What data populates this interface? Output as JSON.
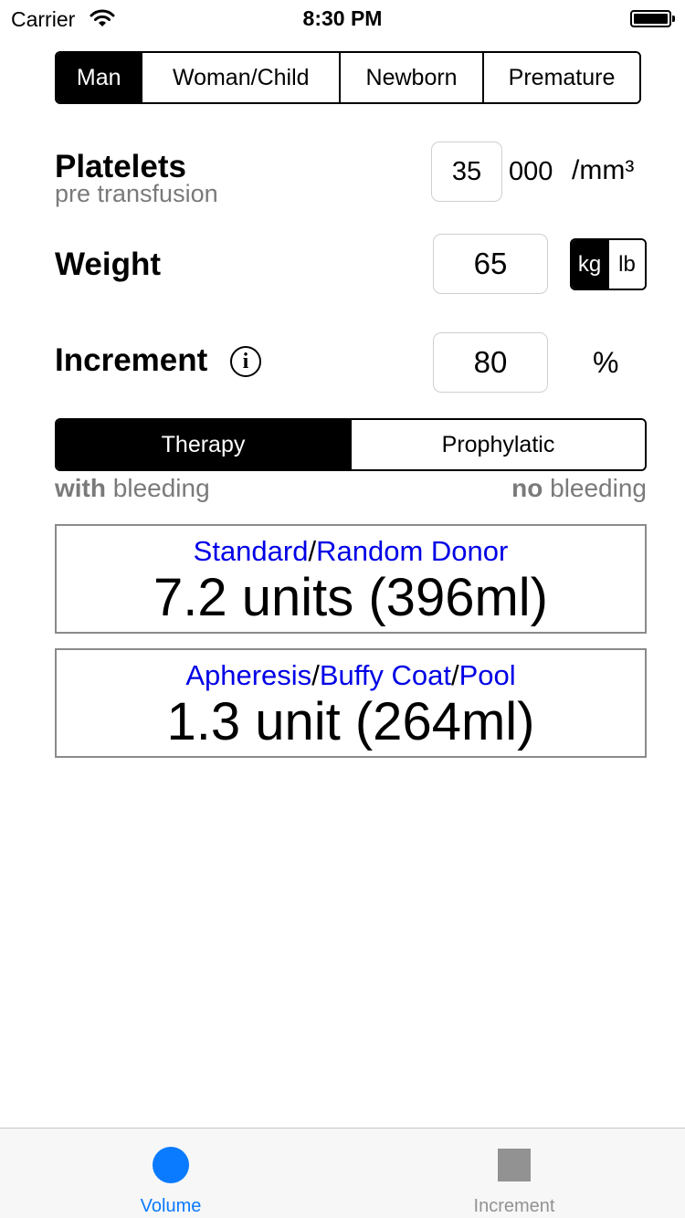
{
  "status_bar": {
    "carrier": "Carrier",
    "time": "8:30 PM",
    "wifi_icon": "wifi-icon",
    "battery_icon": "battery-icon"
  },
  "patient_type": {
    "options": [
      "Man",
      "Woman/Child",
      "Newborn",
      "Premature"
    ],
    "selected": "Man"
  },
  "platelets": {
    "label": "Platelets",
    "sublabel": "pre transfusion",
    "value": "35",
    "suffix": "000",
    "unit": "/mm³"
  },
  "weight": {
    "label": "Weight",
    "value": "65",
    "unit_options": [
      "kg",
      "lb"
    ],
    "unit_selected": "kg"
  },
  "increment": {
    "label": "Increment",
    "info_icon": "info-icon",
    "value": "80",
    "unit": "%"
  },
  "mode": {
    "options": [
      "Therapy",
      "Prophylatic"
    ],
    "selected": "Therapy",
    "left_hint_bold": "with",
    "left_hint_rest": " bleeding",
    "right_hint_bold": "no",
    "right_hint_rest": " bleeding"
  },
  "results": [
    {
      "types": [
        "Standard",
        "Random Donor"
      ],
      "value": "7.2 units (396ml)"
    },
    {
      "types": [
        "Apheresis",
        "Buffy Coat",
        "Pool"
      ],
      "value": "1.3 unit (264ml)"
    }
  ],
  "tab_bar": {
    "tabs": [
      {
        "label": "Volume",
        "icon": "circle-icon",
        "active": true
      },
      {
        "label": "Increment",
        "icon": "square-icon",
        "active": false
      }
    ]
  },
  "colors": {
    "accent": "#0a7aff",
    "link_blue": "#0000e6",
    "inactive_gray": "#929292",
    "hint_gray": "#7a7a7a"
  }
}
